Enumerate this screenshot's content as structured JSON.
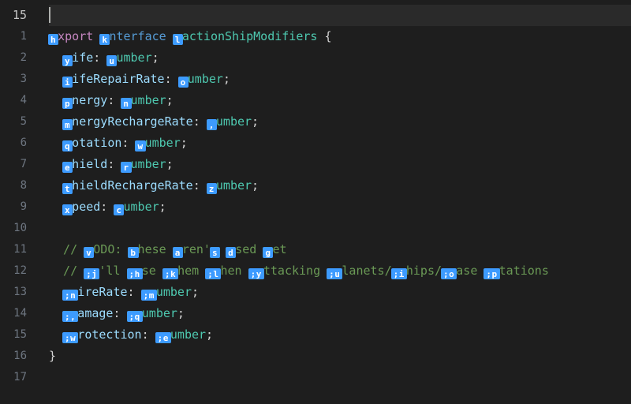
{
  "header_line_number": "15",
  "lines": [
    {
      "n": "1",
      "indent": 0,
      "tokens": [
        {
          "txt": "e",
          "cls": "kw",
          "hint": "h"
        },
        {
          "txt": "xport ",
          "cls": "kw"
        },
        {
          "txt": "i",
          "cls": "kw2",
          "hint": "k"
        },
        {
          "txt": "nterface ",
          "cls": "kw2"
        },
        {
          "txt": "F",
          "cls": "type",
          "hint": "l"
        },
        {
          "txt": "actionShipModifiers ",
          "cls": "type"
        },
        {
          "txt": "{",
          "cls": "pun"
        }
      ]
    },
    {
      "n": "2",
      "indent": 1,
      "tokens": [
        {
          "txt": "l",
          "cls": "prop",
          "hint": "y"
        },
        {
          "txt": "ife",
          "cls": "prop"
        },
        {
          "txt": ": ",
          "cls": "pun"
        },
        {
          "txt": "n",
          "cls": "type",
          "hint": "u"
        },
        {
          "txt": "umber",
          "cls": "type"
        },
        {
          "txt": ";",
          "cls": "pun"
        }
      ]
    },
    {
      "n": "3",
      "indent": 1,
      "tokens": [
        {
          "txt": "l",
          "cls": "prop",
          "hint": "i"
        },
        {
          "txt": "ifeRepairRate",
          "cls": "prop"
        },
        {
          "txt": ": ",
          "cls": "pun"
        },
        {
          "txt": "n",
          "cls": "type",
          "hint": "o"
        },
        {
          "txt": "umber",
          "cls": "type"
        },
        {
          "txt": ";",
          "cls": "pun"
        }
      ]
    },
    {
      "n": "4",
      "indent": 1,
      "tokens": [
        {
          "txt": "e",
          "cls": "prop",
          "hint": "p"
        },
        {
          "txt": "nergy",
          "cls": "prop"
        },
        {
          "txt": ": ",
          "cls": "pun"
        },
        {
          "txt": "n",
          "cls": "type",
          "hint": "n"
        },
        {
          "txt": "umber",
          "cls": "type"
        },
        {
          "txt": ";",
          "cls": "pun"
        }
      ]
    },
    {
      "n": "5",
      "indent": 1,
      "tokens": [
        {
          "txt": "e",
          "cls": "prop",
          "hint": "m"
        },
        {
          "txt": "nergyRechargeRate",
          "cls": "prop"
        },
        {
          "txt": ": ",
          "cls": "pun"
        },
        {
          "txt": "n",
          "cls": "type",
          "hint": ","
        },
        {
          "txt": "umber",
          "cls": "type"
        },
        {
          "txt": ";",
          "cls": "pun"
        }
      ]
    },
    {
      "n": "6",
      "indent": 1,
      "tokens": [
        {
          "txt": "r",
          "cls": "prop",
          "hint": "q"
        },
        {
          "txt": "otation",
          "cls": "prop"
        },
        {
          "txt": ": ",
          "cls": "pun"
        },
        {
          "txt": "n",
          "cls": "type",
          "hint": "w"
        },
        {
          "txt": "umber",
          "cls": "type"
        },
        {
          "txt": ";",
          "cls": "pun"
        }
      ]
    },
    {
      "n": "7",
      "indent": 1,
      "tokens": [
        {
          "txt": "s",
          "cls": "prop",
          "hint": "e"
        },
        {
          "txt": "hield",
          "cls": "prop"
        },
        {
          "txt": ": ",
          "cls": "pun"
        },
        {
          "txt": "n",
          "cls": "type",
          "hint": "r"
        },
        {
          "txt": "umber",
          "cls": "type"
        },
        {
          "txt": ";",
          "cls": "pun"
        }
      ]
    },
    {
      "n": "8",
      "indent": 1,
      "tokens": [
        {
          "txt": "s",
          "cls": "prop",
          "hint": "t"
        },
        {
          "txt": "hieldRechargeRate",
          "cls": "prop"
        },
        {
          "txt": ": ",
          "cls": "pun"
        },
        {
          "txt": "n",
          "cls": "type",
          "hint": "z"
        },
        {
          "txt": "umber",
          "cls": "type"
        },
        {
          "txt": ";",
          "cls": "pun"
        }
      ]
    },
    {
      "n": "9",
      "indent": 1,
      "tokens": [
        {
          "txt": "s",
          "cls": "prop",
          "hint": "x"
        },
        {
          "txt": "peed",
          "cls": "prop"
        },
        {
          "txt": ": ",
          "cls": "pun"
        },
        {
          "txt": "n",
          "cls": "type",
          "hint": "c"
        },
        {
          "txt": "umber",
          "cls": "type"
        },
        {
          "txt": ";",
          "cls": "pun"
        }
      ]
    },
    {
      "n": "10",
      "indent": 0,
      "tokens": []
    },
    {
      "n": "11",
      "indent": 1,
      "tokens": [
        {
          "txt": "// ",
          "cls": "cmt"
        },
        {
          "txt": "T",
          "cls": "cmt",
          "hint": "v"
        },
        {
          "txt": "ODO: ",
          "cls": "cmt"
        },
        {
          "txt": "t",
          "cls": "cmt",
          "hint": "b"
        },
        {
          "txt": "hese ",
          "cls": "cmt"
        },
        {
          "txt": "a",
          "cls": "cmt",
          "hint": "a"
        },
        {
          "txt": "ren'",
          "cls": "cmt"
        },
        {
          "txt": "t",
          "cls": "cmt",
          "hint": "s"
        },
        {
          "txt": " ",
          "cls": "cmt"
        },
        {
          "txt": "u",
          "cls": "cmt",
          "hint": "d"
        },
        {
          "txt": "sed ",
          "cls": "cmt"
        },
        {
          "txt": "y",
          "cls": "cmt",
          "hint": "g"
        },
        {
          "txt": "et",
          "cls": "cmt"
        }
      ]
    },
    {
      "n": "12",
      "indent": 1,
      "tokens": [
        {
          "txt": "// ",
          "cls": "cmt"
        },
        {
          "txt": "I",
          "cls": "cmt",
          "hint": ";j"
        },
        {
          "txt": "'ll ",
          "cls": "cmt"
        },
        {
          "txt": "u",
          "cls": "cmt",
          "hint": ";h"
        },
        {
          "txt": "se ",
          "cls": "cmt"
        },
        {
          "txt": "t",
          "cls": "cmt",
          "hint": ";k"
        },
        {
          "txt": "hem ",
          "cls": "cmt"
        },
        {
          "txt": "w",
          "cls": "cmt",
          "hint": ";l"
        },
        {
          "txt": "hen ",
          "cls": "cmt"
        },
        {
          "txt": "a",
          "cls": "cmt",
          "hint": ";y"
        },
        {
          "txt": "ttacking ",
          "cls": "cmt"
        },
        {
          "txt": "p",
          "cls": "cmt",
          "hint": ";u"
        },
        {
          "txt": "lanets/",
          "cls": "cmt"
        },
        {
          "txt": "s",
          "cls": "cmt",
          "hint": ";i"
        },
        {
          "txt": "hips/",
          "cls": "cmt"
        },
        {
          "txt": "b",
          "cls": "cmt",
          "hint": ";o"
        },
        {
          "txt": "ase ",
          "cls": "cmt"
        },
        {
          "txt": "s",
          "cls": "cmt",
          "hint": ";p"
        },
        {
          "txt": "tations",
          "cls": "cmt"
        }
      ]
    },
    {
      "n": "13",
      "indent": 1,
      "tokens": [
        {
          "txt": "f",
          "cls": "prop",
          "hint": ";n"
        },
        {
          "txt": "ireRate",
          "cls": "prop"
        },
        {
          "txt": ": ",
          "cls": "pun"
        },
        {
          "txt": "n",
          "cls": "type",
          "hint": ";m"
        },
        {
          "txt": "umber",
          "cls": "type"
        },
        {
          "txt": ";",
          "cls": "pun"
        }
      ]
    },
    {
      "n": "14",
      "indent": 1,
      "tokens": [
        {
          "txt": "d",
          "cls": "prop",
          "hint": ";,"
        },
        {
          "txt": "amage",
          "cls": "prop"
        },
        {
          "txt": ": ",
          "cls": "pun"
        },
        {
          "txt": "n",
          "cls": "type",
          "hint": ";q"
        },
        {
          "txt": "umber",
          "cls": "type"
        },
        {
          "txt": ";",
          "cls": "pun"
        }
      ]
    },
    {
      "n": "15",
      "indent": 1,
      "tokens": [
        {
          "txt": "p",
          "cls": "prop",
          "hint": ";w"
        },
        {
          "txt": "rotection",
          "cls": "prop"
        },
        {
          "txt": ": ",
          "cls": "pun"
        },
        {
          "txt": "n",
          "cls": "type",
          "hint": ";e"
        },
        {
          "txt": "umber",
          "cls": "type"
        },
        {
          "txt": ";",
          "cls": "pun"
        }
      ]
    },
    {
      "n": "16",
      "indent": 0,
      "tokens": [
        {
          "txt": "}",
          "cls": "pun"
        }
      ]
    },
    {
      "n": "17",
      "indent": 0,
      "tokens": []
    }
  ]
}
